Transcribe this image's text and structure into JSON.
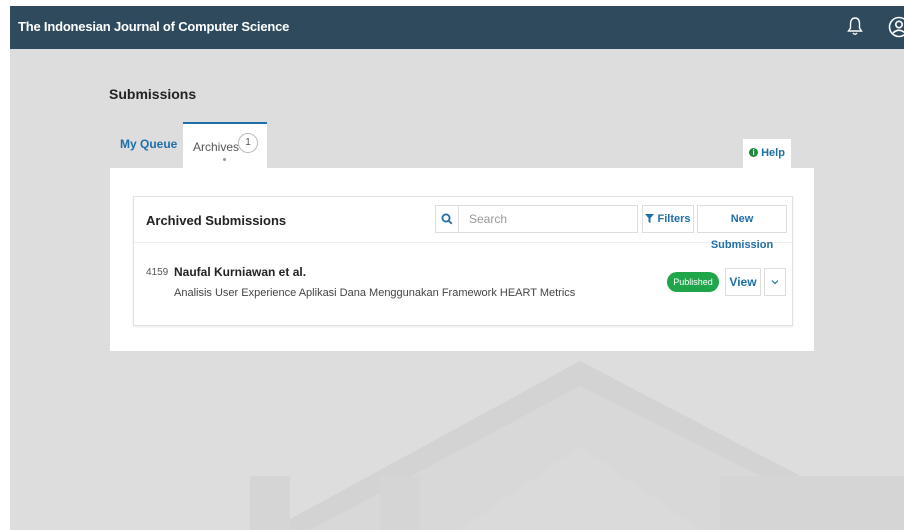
{
  "header": {
    "title": "The Indonesian Journal of Computer Science",
    "icons": [
      "bell-icon",
      "user-icon"
    ]
  },
  "page": {
    "title": "Submissions"
  },
  "tabs": {
    "queue_label": "My Queue",
    "archives_label": "Archives",
    "archives_count": "1"
  },
  "help": {
    "label": "Help",
    "icon": "info-icon"
  },
  "archive": {
    "heading": "Archived Submissions",
    "search_placeholder": "Search",
    "filters_label": "Filters",
    "new_submission_label": "New Submission"
  },
  "submissions": [
    {
      "id": "4159",
      "authors": "Naufal Kurniawan et al.",
      "title": "Analisis User Experience Aplikasi Dana Menggunakan Framework HEART Metrics",
      "status": "Published",
      "view_label": "View"
    }
  ],
  "colors": {
    "header_bg": "#2e4a5c",
    "accent": "#1e6fa8",
    "published": "#1fa64a",
    "background": "#dddddd"
  }
}
